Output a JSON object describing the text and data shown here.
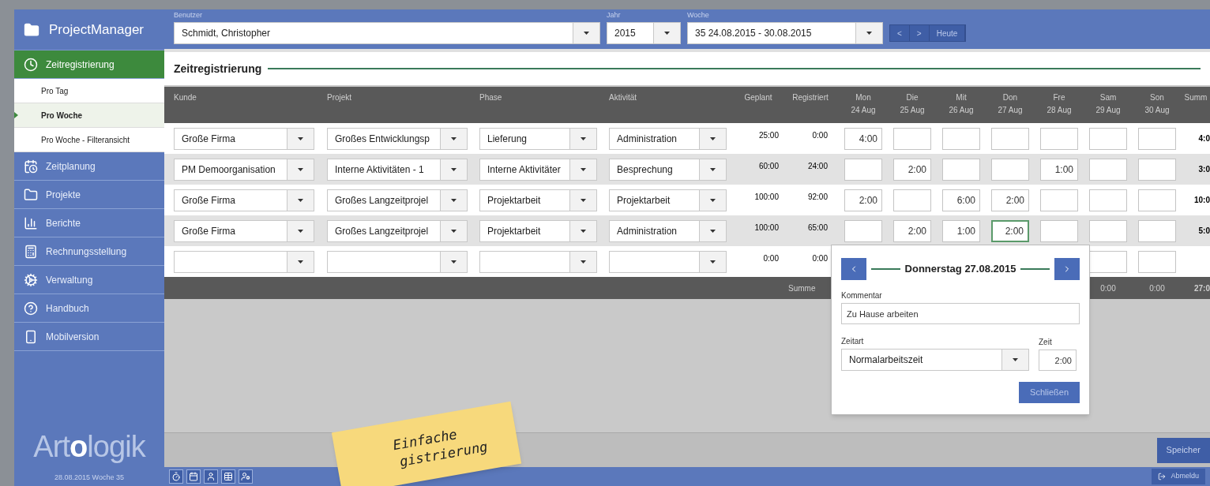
{
  "sidebar": {
    "app_title": "ProjectManager",
    "items": [
      {
        "label": "Zeitregistrierung",
        "selected": true,
        "children": [
          {
            "label": "Pro Tag",
            "selected": false
          },
          {
            "label": "Pro Woche",
            "selected": true
          },
          {
            "label": "Pro Woche - Filteransicht",
            "selected": false
          }
        ]
      },
      {
        "label": "Zeitplanung",
        "selected": false
      },
      {
        "label": "Projekte",
        "selected": false
      },
      {
        "label": "Berichte",
        "selected": false
      },
      {
        "label": "Rechnungsstellung",
        "selected": false
      },
      {
        "label": "Verwaltung",
        "selected": false
      },
      {
        "label": "Handbuch",
        "selected": false
      },
      {
        "label": "Mobilversion",
        "selected": false
      }
    ],
    "logo": {
      "before": "Art",
      "highlight": "o",
      "after": "logik"
    },
    "status": "28.08.2015 Woche 35"
  },
  "toolbar": {
    "user": {
      "label": "Benutzer",
      "value": "Schmidt, Christopher"
    },
    "year": {
      "label": "Jahr",
      "value": "2015"
    },
    "week": {
      "label": "Woche",
      "value": "35  24.08.2015  -  30.08.2015"
    },
    "buttons": [
      "<",
      ">",
      "Heute"
    ]
  },
  "section_title": "Zeitregistrierung",
  "table": {
    "columns": [
      {
        "label": "Kunde"
      },
      {
        "label": "Projekt"
      },
      {
        "label": "Phase"
      },
      {
        "label": "Aktivität"
      },
      {
        "label": "Geplant"
      },
      {
        "label": "Registriert"
      },
      {
        "label": "Mon",
        "sub": "24 Aug"
      },
      {
        "label": "Die",
        "sub": "25 Aug"
      },
      {
        "label": "Mit",
        "sub": "26 Aug"
      },
      {
        "label": "Don",
        "sub": "27 Aug"
      },
      {
        "label": "Fre",
        "sub": "28 Aug"
      },
      {
        "label": "Sam",
        "sub": "29 Aug"
      },
      {
        "label": "Son",
        "sub": "30 Aug"
      },
      {
        "label": "Summ"
      }
    ],
    "rows": [
      {
        "kunde": "Große Firma",
        "projekt": "Großes Entwicklungsp",
        "phase": "Lieferung",
        "aktivitaet": "Administration",
        "geplant": "25:00",
        "registriert": "0:00",
        "days": [
          {
            "value": "4:00",
            "selected": false
          },
          {
            "selected": false
          },
          {
            "selected": false
          },
          {
            "selected": false
          },
          {
            "selected": false
          },
          {
            "selected": false
          },
          {
            "selected": false
          }
        ],
        "summe": "4:0"
      },
      {
        "kunde": "PM Demoorganisation",
        "projekt": "Interne Aktivitäten - 1",
        "phase": "Interne Aktivitäter",
        "aktivitaet": "Besprechung",
        "geplant": "60:00",
        "registriert": "24:00",
        "days": [
          {
            "selected": false
          },
          {
            "value": "2:00",
            "selected": false
          },
          {
            "selected": false
          },
          {
            "selected": false
          },
          {
            "value": "1:00",
            "selected": false
          },
          {
            "selected": false
          },
          {
            "selected": false
          }
        ],
        "summe": "3:0"
      },
      {
        "kunde": "Große Firma",
        "projekt": "Großes Langzeitprojel",
        "phase": "Projektarbeit",
        "aktivitaet": "Projektarbeit",
        "geplant": "100:00",
        "registriert": "92:00",
        "days": [
          {
            "value": "2:00",
            "selected": false
          },
          {
            "selected": false
          },
          {
            "value": "6:00",
            "selected": false
          },
          {
            "value": "2:00",
            "selected": false
          },
          {
            "selected": false
          },
          {
            "selected": false
          },
          {
            "selected": false
          }
        ],
        "summe": "10:0"
      },
      {
        "kunde": "Große Firma",
        "projekt": "Großes Langzeitprojel",
        "phase": "Projektarbeit",
        "aktivitaet": "Administration",
        "geplant": "100:00",
        "registriert": "65:00",
        "days": [
          {
            "selected": false
          },
          {
            "value": "2:00",
            "selected": false
          },
          {
            "value": "1:00",
            "selected": false
          },
          {
            "value": "2:00",
            "selected": true
          },
          {
            "selected": false
          },
          {
            "selected": false
          },
          {
            "selected": false
          }
        ],
        "summe": "5:0"
      },
      {
        "geplant": "0:00",
        "registriert": "0:00"
      }
    ],
    "footer": {
      "label": "Summe",
      "sam": "0:00",
      "son": "0:00",
      "total": "27:0"
    }
  },
  "popup": {
    "title": "Donnerstag 27.08.2015",
    "comment_label": "Kommentar",
    "comment": "Zu Hause arbeiten",
    "type_label": "Zeitart",
    "type": "Normalarbeitszeit",
    "time_label": "Zeit",
    "time": "2:00",
    "close": "Schließen"
  },
  "save_button": "Speicher",
  "logout": "Abmeldu",
  "note": [
    "Einfache",
    "gistrierung"
  ]
}
